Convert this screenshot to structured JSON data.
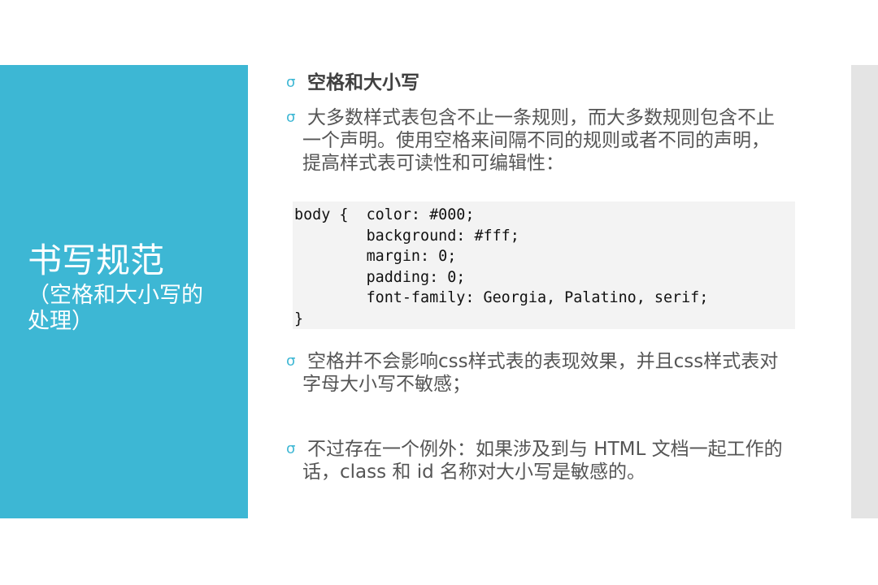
{
  "slide": {
    "title": "书写规范",
    "subtitle": "（空格和大小写的处理）",
    "bullets": [
      "空格和大小写",
      "大多数样式表包含不止一条规则，而大多数规则包含不止一个声明。使用空格来间隔不同的规则或者不同的声明，提高样式表可读性和可编辑性：",
      "空格并不会影响css样式表的表现效果，并且css样式表对字母大小写不敏感；",
      "不过存在一个例外：如果涉及到与 HTML 文档一起工作的话，class 和 id 名称对大小写是敏感的。"
    ],
    "code": "body {  color: #000;\n        background: #fff;\n        margin: 0;\n        padding: 0;\n        font-family: Georgia, Palatino, serif;\n}",
    "bullet_icon": "curly-bullet-icon",
    "colors": {
      "accent": "#3db7d4",
      "sidebar": "#e4e4e4",
      "text": "#555555",
      "code_bg": "#f3f3f3"
    }
  }
}
